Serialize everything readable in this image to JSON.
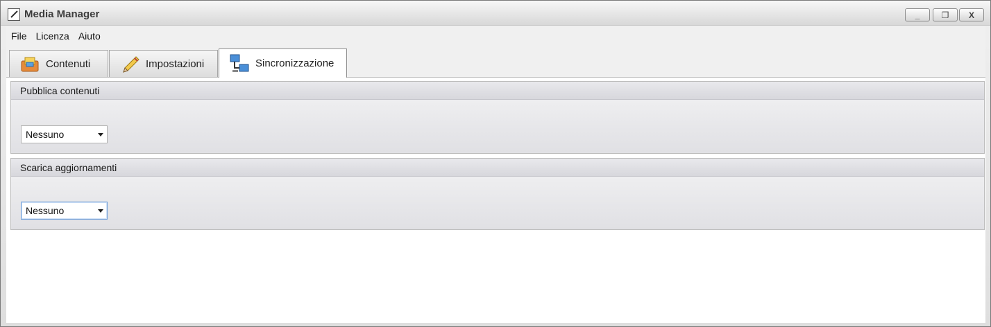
{
  "window": {
    "title": "Media Manager",
    "controls": {
      "minimize": "_",
      "restore": "❐",
      "close": "X"
    }
  },
  "menu": [
    {
      "label": "File"
    },
    {
      "label": "Licenza"
    },
    {
      "label": "Aiuto"
    }
  ],
  "tabs": [
    {
      "label": "Contenuti",
      "icon": "box-icon",
      "active": false
    },
    {
      "label": "Impostazioni",
      "icon": "pencil-icon",
      "active": false
    },
    {
      "label": "Sincronizzazione",
      "icon": "network-icon",
      "active": true
    }
  ],
  "sections": [
    {
      "title": "Pubblica contenuti",
      "select_value": "Nessuno"
    },
    {
      "title": "Scarica aggiornamenti",
      "select_value": "Nessuno"
    }
  ],
  "colors": {
    "focus_border": "#6f9ed8",
    "group_header": "#dcdce1"
  }
}
